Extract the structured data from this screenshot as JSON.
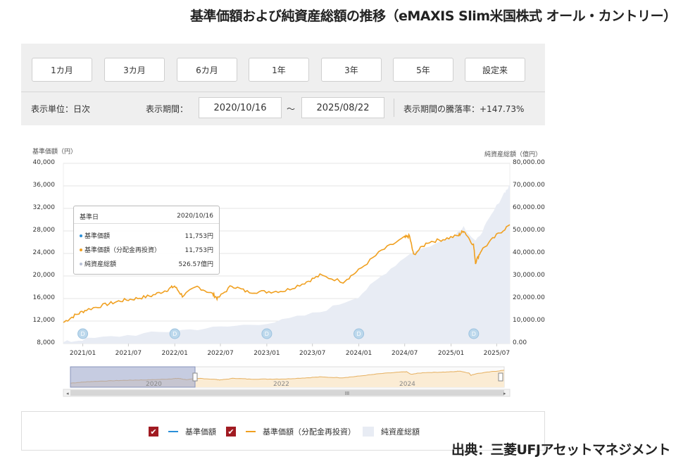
{
  "title": "基準価額および純資産総額の推移（eMAXIS Slim米国株式 オール・カントリー）",
  "periods": [
    "1カ月",
    "3カ月",
    "6カ月",
    "1年",
    "3年",
    "5年",
    "設定来"
  ],
  "display_unit": "表示単位：日次",
  "display_period_label": "表示期間：",
  "date_from": "2020/10/16",
  "date_sep": "～",
  "date_to": "2025/08/22",
  "change_rate": "表示期間の騰落率：+147.73%",
  "tooltip": {
    "header_label": "基準日",
    "header_value": "2020/10/16",
    "rows": [
      {
        "label": "基準価額",
        "value": "11,753円"
      },
      {
        "label": "基準価額（分配金再投資）",
        "value": "11,753円"
      },
      {
        "label": "純資産総額",
        "value": "526.57億円"
      }
    ]
  },
  "legend": [
    "基準価額",
    "基準価額（分配金再投資）",
    "純資産総額"
  ],
  "navigator_labels": [
    "2020",
    "2022",
    "2024"
  ],
  "navigator_scroll": "III",
  "source": "出典：三菱UFJアセットマネジメント",
  "colors": {
    "nav_line": "#f0a020",
    "nav_line_blue": "#2a8fd8",
    "assets_fill": "#e8ecf4",
    "checkbox": "#a11b22"
  },
  "chart_data": {
    "type": "line",
    "x_axis": "date",
    "x_ticks": [
      "2021/01",
      "2021/07",
      "2022/01",
      "2022/07",
      "2023/01",
      "2023/07",
      "2024/01",
      "2024/07",
      "2025/01",
      "2025/07"
    ],
    "y_left": {
      "title": "基準価額（円）",
      "ticks": [
        "8,000",
        "12,000",
        "16,000",
        "20,000",
        "24,000",
        "28,000",
        "32,000",
        "36,000",
        "40,000"
      ],
      "range": [
        8000,
        40000
      ]
    },
    "y_right": {
      "title": "純資産総額（億円）",
      "ticks": [
        "0.00",
        "10,000.00",
        "20,000.00",
        "30,000.00",
        "40,000.00",
        "50,000.00",
        "60,000.00",
        "70,000.00",
        "80,000.00"
      ],
      "range": [
        0,
        80000
      ]
    },
    "series": [
      {
        "name": "基準価額（分配金再投資）",
        "axis": "left",
        "type": "line",
        "points": [
          [
            "2020/10/16",
            11753
          ],
          [
            "2020/11/30",
            13000
          ],
          [
            "2021/01/15",
            14000
          ],
          [
            "2021/03/31",
            14900
          ],
          [
            "2021/05/31",
            15600
          ],
          [
            "2021/07/31",
            16000
          ],
          [
            "2021/09/30",
            16500
          ],
          [
            "2021/11/30",
            17500
          ],
          [
            "2021/12/31",
            18200
          ],
          [
            "2022/01/31",
            16500
          ],
          [
            "2022/03/31",
            18100
          ],
          [
            "2022/05/31",
            16800
          ],
          [
            "2022/06/20",
            16000
          ],
          [
            "2022/08/15",
            18300
          ],
          [
            "2022/10/15",
            17200
          ],
          [
            "2022/12/31",
            17200
          ],
          [
            "2023/03/15",
            17400
          ],
          [
            "2023/05/31",
            18800
          ],
          [
            "2023/07/31",
            20100
          ],
          [
            "2023/10/31",
            19000
          ],
          [
            "2023/12/31",
            21000
          ],
          [
            "2024/03/31",
            24500
          ],
          [
            "2024/06/30",
            26800
          ],
          [
            "2024/07/20",
            27100
          ],
          [
            "2024/08/05",
            23800
          ],
          [
            "2024/09/30",
            26000
          ],
          [
            "2024/11/30",
            26500
          ],
          [
            "2025/01/31",
            27200
          ],
          [
            "2025/02/20",
            28100
          ],
          [
            "2025/03/31",
            25500
          ],
          [
            "2025/04/08",
            22400
          ],
          [
            "2025/04/30",
            24500
          ],
          [
            "2025/06/30",
            27200
          ],
          [
            "2025/08/22",
            29100
          ]
        ]
      },
      {
        "name": "純資産総額",
        "axis": "right",
        "type": "area",
        "points": [
          [
            "2020/10/16",
            527
          ],
          [
            "2021/01/15",
            2000
          ],
          [
            "2021/07/31",
            4000
          ],
          [
            "2022/01/31",
            6000
          ],
          [
            "2022/07/31",
            7500
          ],
          [
            "2023/01/31",
            9500
          ],
          [
            "2023/07/31",
            14000
          ],
          [
            "2023/12/31",
            21000
          ],
          [
            "2024/03/31",
            30000
          ],
          [
            "2024/07/20",
            40000
          ],
          [
            "2024/12/31",
            47000
          ],
          [
            "2025/02/20",
            52000
          ],
          [
            "2025/04/08",
            45000
          ],
          [
            "2025/05/31",
            55000
          ],
          [
            "2025/07/31",
            67000
          ],
          [
            "2025/08/22",
            70000
          ]
        ]
      }
    ],
    "dividend_markers": [
      "2021/01",
      "2022/01",
      "2023/01",
      "2024/01",
      "2025/04"
    ],
    "legend_position": "bottom"
  }
}
